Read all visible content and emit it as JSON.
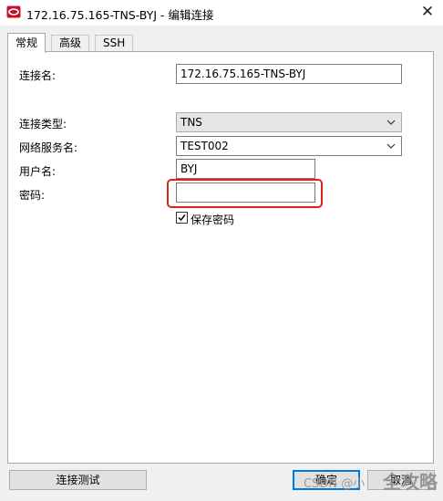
{
  "window": {
    "title": "172.16.75.165-TNS-BYJ - 编辑连接",
    "close_glyph": "✕"
  },
  "tabs": [
    {
      "label": "常规",
      "active": true
    },
    {
      "label": "高级",
      "active": false
    },
    {
      "label": "SSH",
      "active": false
    }
  ],
  "form": {
    "connection_name": {
      "label": "连接名:",
      "value": "172.16.75.165-TNS-BYJ"
    },
    "connection_type": {
      "label": "连接类型:",
      "value": "TNS"
    },
    "net_service_name": {
      "label": "网络服务名:",
      "value": "TEST002"
    },
    "username": {
      "label": "用户名:",
      "value": "BYJ"
    },
    "password": {
      "label": "密码:",
      "value": ""
    },
    "save_password": {
      "label": "保存密码",
      "checked": true
    }
  },
  "buttons": {
    "test": "连接测试",
    "ok": "确定",
    "cancel": "取消"
  },
  "watermark": {
    "text": "CSDN @小",
    "logo": "全攻略"
  },
  "colors": {
    "highlight": "#e0211a",
    "focus": "#0078d7",
    "app_icon": "#c8102e"
  }
}
